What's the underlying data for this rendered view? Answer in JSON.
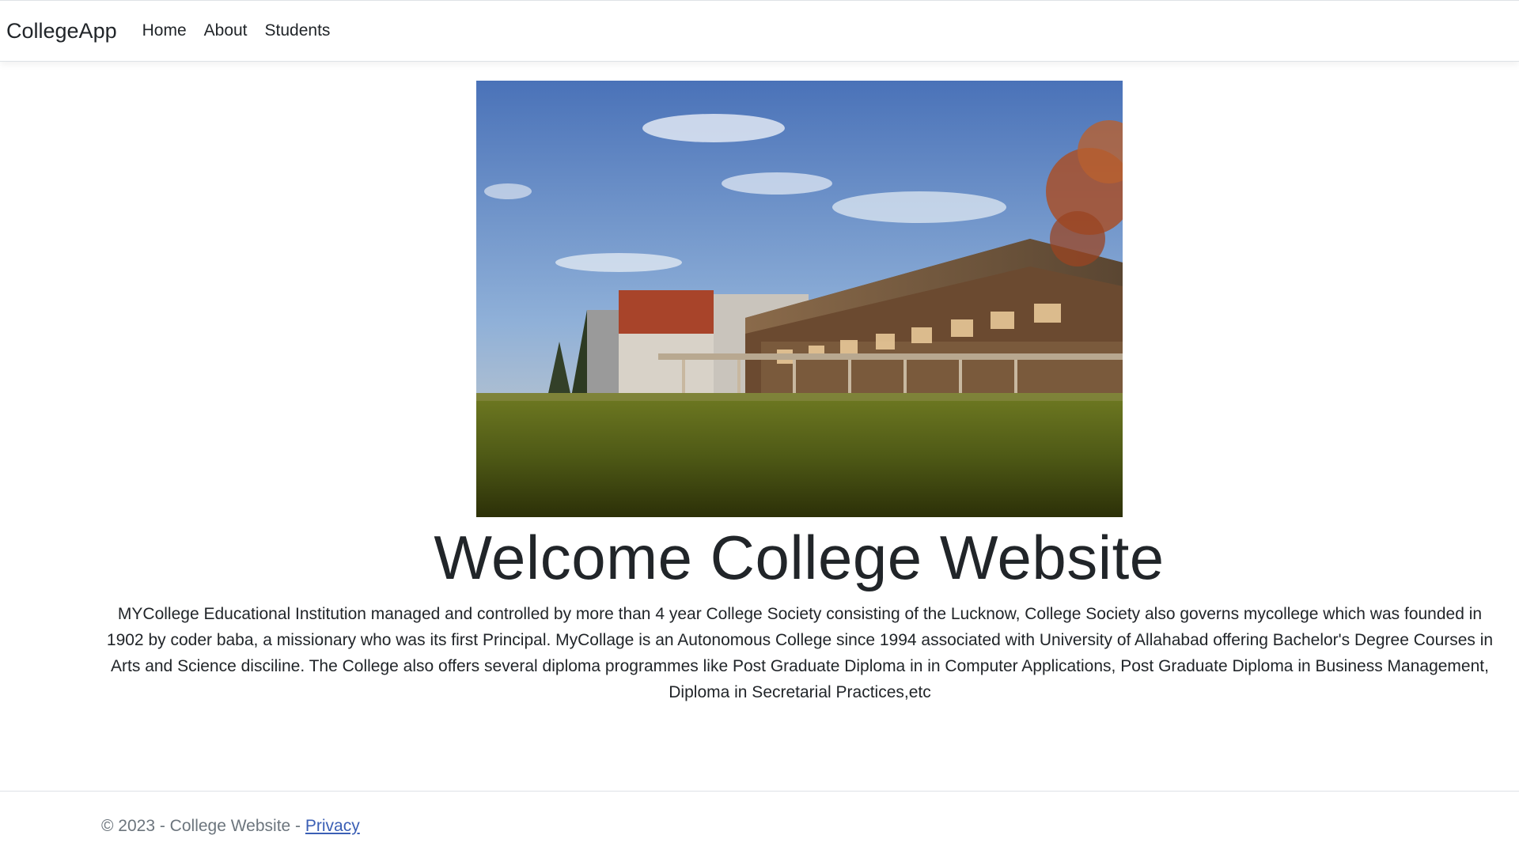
{
  "navbar": {
    "brand": "CollegeApp",
    "links": [
      {
        "label": "Home"
      },
      {
        "label": "About"
      },
      {
        "label": "Students"
      }
    ]
  },
  "main": {
    "title": "Welcome College Website",
    "description": "MYCollege Educational Institution managed and controlled by more than 4 year College Society consisting of the Lucknow, College Society also governs mycollege which was founded in 1902 by coder baba, a missionary who was its first Principal. MyCollage is an Autonomous College since 1994 associated with University of Allahabad offering Bachelor's Degree Courses in Arts and Science disciline. The College also offers several diploma programmes like Post Graduate Diploma in in Computer Applications, Post Graduate Diploma in Business Management, Diploma in Secretarial Practices,etc"
  },
  "footer": {
    "copyright": "© 2023 - College Website - ",
    "privacy_label": "Privacy"
  },
  "colors": {
    "text": "#212529",
    "muted": "#6c757d",
    "link": "#3b5fb5",
    "border": "#dee2e6"
  }
}
